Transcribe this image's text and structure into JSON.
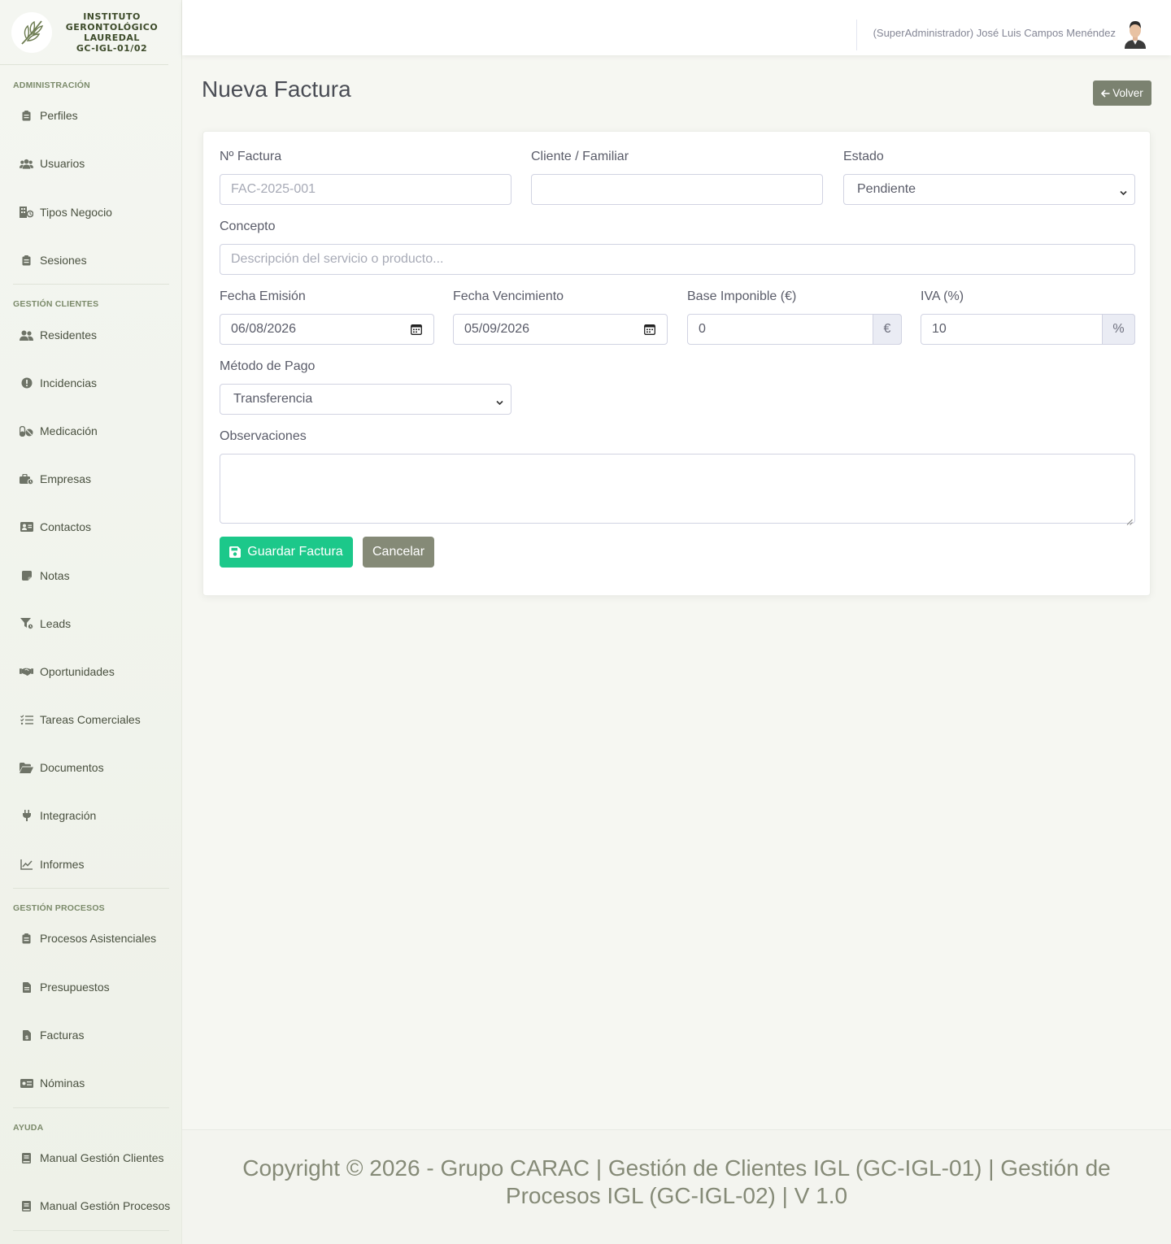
{
  "brand": {
    "line1": "INSTITUTO",
    "line2": "GERONTOLÓGICO",
    "line3": "LAUREDAL",
    "line4": "GC-IGL-01/02"
  },
  "sidebar": {
    "sections": [
      {
        "heading": "Administración",
        "items": [
          {
            "label": "Perfiles",
            "icon": "clipboard-icon"
          },
          {
            "label": "Usuarios",
            "icon": "users-icon"
          },
          {
            "label": "Tipos Negocio",
            "icon": "building-icon"
          },
          {
            "label": "Sesiones",
            "icon": "clipboard-icon"
          }
        ]
      },
      {
        "heading": "Gestión Clientes",
        "items": [
          {
            "label": "Residentes",
            "icon": "users-icon"
          },
          {
            "label": "Incidencias",
            "icon": "exclamation-circle-icon"
          },
          {
            "label": "Medicación",
            "icon": "pills-icon"
          },
          {
            "label": "Empresas",
            "icon": "briefcase-icon"
          },
          {
            "label": "Contactos",
            "icon": "address-card-icon"
          },
          {
            "label": "Notas",
            "icon": "sticky-note-icon"
          },
          {
            "label": "Leads",
            "icon": "funnel-icon"
          },
          {
            "label": "Oportunidades",
            "icon": "handshake-icon"
          },
          {
            "label": "Tareas Comerciales",
            "icon": "task-list-icon"
          },
          {
            "label": "Documentos",
            "icon": "folder-open-icon"
          },
          {
            "label": "Integración",
            "icon": "plug-icon"
          },
          {
            "label": "Informes",
            "icon": "line-chart-icon"
          }
        ]
      },
      {
        "heading": "Gestión Procesos",
        "items": [
          {
            "label": "Procesos Asistenciales",
            "icon": "clipboard-icon"
          },
          {
            "label": "Presupuestos",
            "icon": "file-icon"
          },
          {
            "label": "Facturas",
            "icon": "invoice-icon"
          },
          {
            "label": "Nóminas",
            "icon": "money-bill-icon"
          }
        ]
      },
      {
        "heading": "Ayuda",
        "items": [
          {
            "label": "Manual Gestión Clientes",
            "icon": "book-icon"
          },
          {
            "label": "Manual Gestión Procesos",
            "icon": "book-icon"
          }
        ]
      }
    ]
  },
  "topbar": {
    "user": "(SuperAdministrador) José Luis Campos Menéndez"
  },
  "page": {
    "title": "Nueva Factura",
    "back_label": "Volver"
  },
  "form": {
    "invoice_number": {
      "label": "Nº Factura",
      "placeholder": "FAC-2025-001",
      "value": ""
    },
    "client": {
      "label": "Cliente / Familiar",
      "value": ""
    },
    "status": {
      "label": "Estado",
      "value": "Pendiente"
    },
    "concept": {
      "label": "Concepto",
      "placeholder": "Descripción del servicio o producto...",
      "value": ""
    },
    "issue_date": {
      "label": "Fecha Emisión",
      "value": "06/08/2026"
    },
    "due_date": {
      "label": "Fecha Vencimiento",
      "value": "05/09/2026"
    },
    "base": {
      "label": "Base Imponible (€)",
      "value": "0",
      "addon": "€"
    },
    "vat": {
      "label": "IVA (%)",
      "value": "10",
      "addon": "%"
    },
    "payment_method": {
      "label": "Método de Pago",
      "value": "Transferencia"
    },
    "notes": {
      "label": "Observaciones",
      "value": ""
    },
    "save_label": "Guardar Factura",
    "cancel_label": "Cancelar"
  },
  "footer": {
    "text": "Copyright © 2026 - Grupo CARAC | Gestión de Clientes IGL (GC-IGL-01) | Gestión de Procesos IGL (GC-IGL-02) | V 1.0"
  },
  "colors": {
    "success": "#1cc88a",
    "secondary": "#858a77",
    "brand_text": "#3d4b2a"
  }
}
